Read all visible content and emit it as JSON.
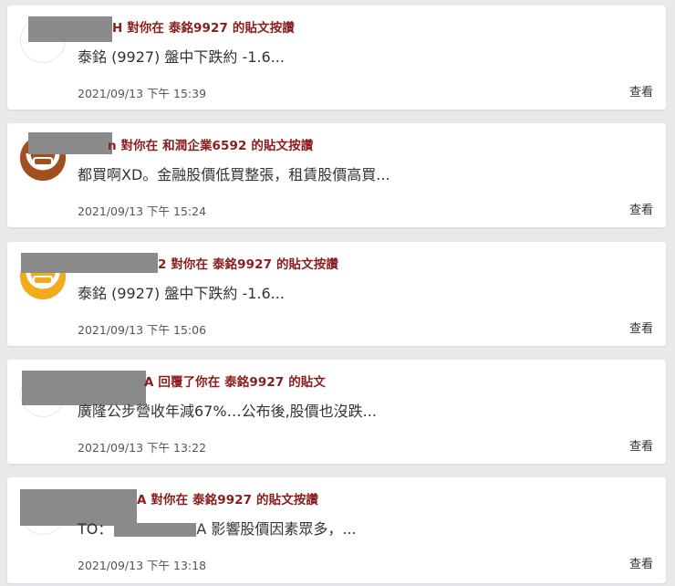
{
  "notifications": [
    {
      "name_tail": "H",
      "action": "對你在",
      "stock": "泰銘9927",
      "suffix": "的貼文按讚",
      "content": "泰銘 (9927) 盤中下跌約 -1.6...",
      "timestamp": "2021/09/13 下午 15:39",
      "view": "查看",
      "avatar": "placeholder"
    },
    {
      "name_tail": "n",
      "action": "對你在",
      "stock": "和潤企業6592",
      "suffix": "的貼文按讚",
      "content": "都買啊XD。金融股價低買整張，租賃股價高買...",
      "timestamp": "2021/09/13 下午 15:24",
      "view": "查看",
      "avatar": "brown"
    },
    {
      "name_tail": "2",
      "action": "對你在",
      "stock": "泰銘9927",
      "suffix": "的貼文按讚",
      "content": "泰銘 (9927) 盤中下跌約 -1.6...",
      "timestamp": "2021/09/13 下午 15:06",
      "view": "查看",
      "avatar": "yellow"
    },
    {
      "name_tail": "A",
      "action": "回覆了你在",
      "stock": "泰銘9927",
      "suffix": "的貼文",
      "content": "廣隆公步營收年減67%…公布後,股價也沒跌...",
      "timestamp": "2021/09/13 下午 13:22",
      "view": "查看",
      "avatar": "placeholder"
    },
    {
      "name_tail": "A",
      "action": "對你在",
      "stock": "泰銘9927",
      "suffix": "的貼文按讚",
      "content_prefix": "TO：",
      "content_suffix": "A 影響股價因素眾多，...",
      "timestamp": "2021/09/13 下午 13:18",
      "view": "查看",
      "avatar": "placeholder"
    }
  ]
}
